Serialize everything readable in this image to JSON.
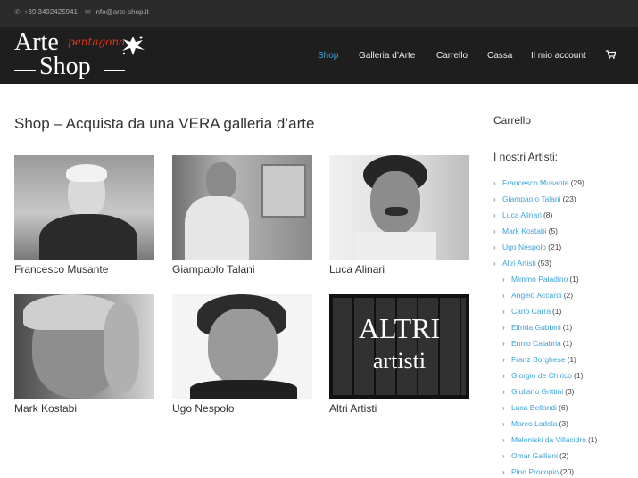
{
  "topbar": {
    "phone": "+39 3492425941",
    "email": "info@arte-shop.it",
    "phone_icon": "phone-icon",
    "email_icon": "envelope-icon"
  },
  "logo": {
    "line1": "Arte",
    "script": "pentagona",
    "line2": "Shop"
  },
  "nav": {
    "items": [
      "Shop",
      "Galleria d’Arte",
      "Carrello",
      "Cassa",
      "Il mio account"
    ],
    "active_color": "#3ea3d8",
    "cart_icon": "cart-icon"
  },
  "main": {
    "title": "Shop – Acquista da una VERA galleria d’arte",
    "artists": [
      {
        "name": "Francesco Musante"
      },
      {
        "name": "Giampaolo Talani"
      },
      {
        "name": "Luca Alinari"
      },
      {
        "name": "Mark Kostabi"
      },
      {
        "name": "Ugo Nespolo"
      },
      {
        "name": "Altri Artisti"
      }
    ],
    "altri_image_text": {
      "line1": "ALTRI",
      "line2": "artisti"
    }
  },
  "sidebar": {
    "cart_title": "Carrello",
    "artists_title": "I nostri Artisti:",
    "items": [
      {
        "name": "Francesco Musante",
        "count": "(29)"
      },
      {
        "name": "Giampaolo Talani",
        "count": "(23)"
      },
      {
        "name": "Luca Alinari",
        "count": "(8)"
      },
      {
        "name": "Mark Kostabi",
        "count": "(5)"
      },
      {
        "name": "Ugo Nespolo",
        "count": "(21)"
      },
      {
        "name": "Altri Artisti",
        "count": "(53)"
      }
    ],
    "sub_items": [
      {
        "name": "Mimmo Paladino",
        "count": "(1)"
      },
      {
        "name": "Angelo Accardi",
        "count": "(2)"
      },
      {
        "name": "Carlo Carrà",
        "count": "(1)"
      },
      {
        "name": "Elfrida Gubbini",
        "count": "(1)"
      },
      {
        "name": "Ennio Calabria",
        "count": "(1)"
      },
      {
        "name": "Franz Borghese",
        "count": "(1)"
      },
      {
        "name": "Giorgio de Chirico",
        "count": "(1)"
      },
      {
        "name": "Giuliano Grittini",
        "count": "(3)"
      },
      {
        "name": "Luca Bellandi",
        "count": "(6)"
      },
      {
        "name": "Marco Lodola",
        "count": "(3)"
      },
      {
        "name": "Meloniski da Villacidro",
        "count": "(1)"
      },
      {
        "name": "Omar Galliani",
        "count": "(2)"
      },
      {
        "name": "Pino Procopio",
        "count": "(20)"
      }
    ],
    "link_color": "#3ea3d8"
  }
}
